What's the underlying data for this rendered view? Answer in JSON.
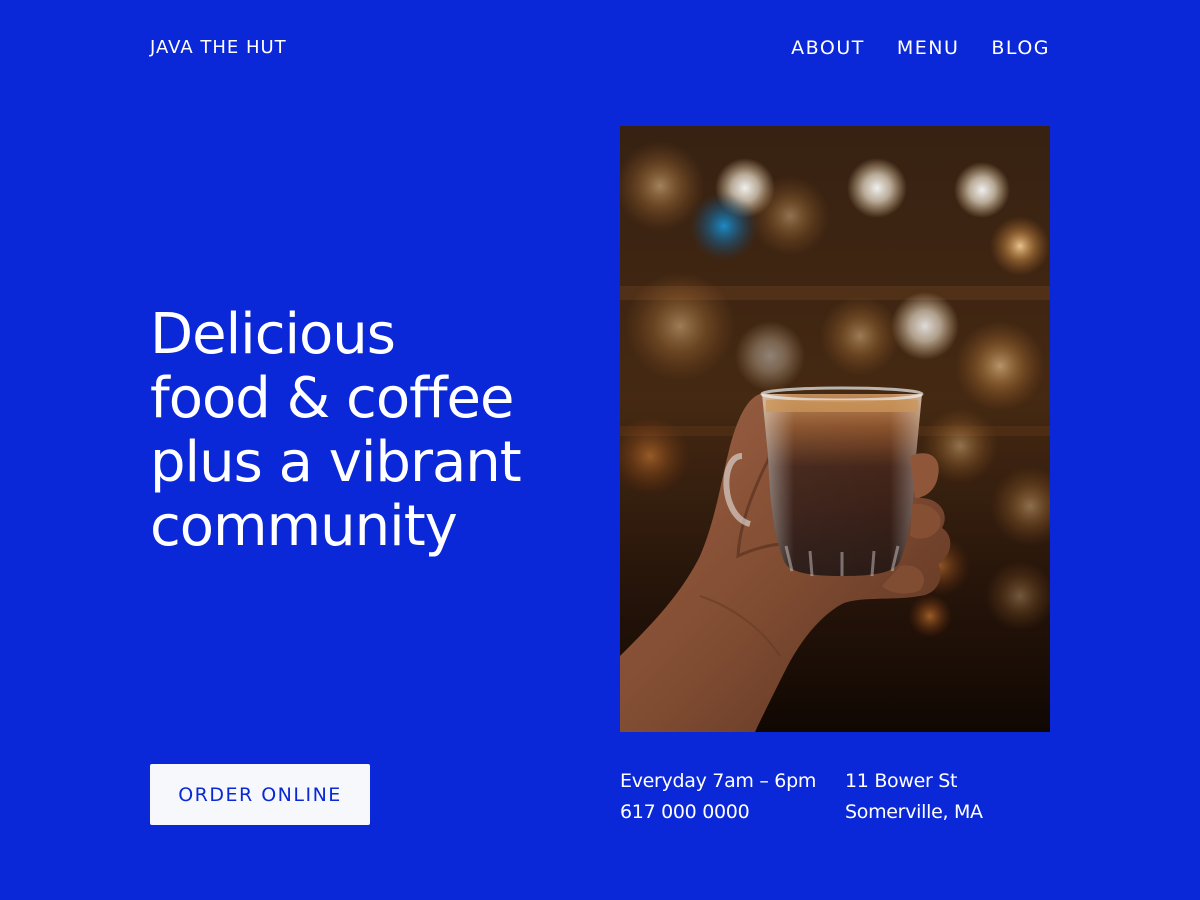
{
  "header": {
    "brand": "JAVA THE HUT",
    "nav": [
      {
        "label": "ABOUT"
      },
      {
        "label": "MENU"
      },
      {
        "label": "BLOG"
      }
    ]
  },
  "hero": {
    "headline_lines": [
      "Delicious",
      "food & coffee",
      "plus a vibrant",
      "community"
    ],
    "cta_label": "ORDER ONLINE"
  },
  "info": {
    "hours": "Everyday 7am – 6pm",
    "phone": "617 000 0000",
    "street": "11 Bower St",
    "city": "Somerville, MA"
  },
  "colors": {
    "background": "#0A28D8",
    "text": "#FFFFFF",
    "button_background": "#F7F8FB",
    "button_text": "#0A28D8"
  }
}
